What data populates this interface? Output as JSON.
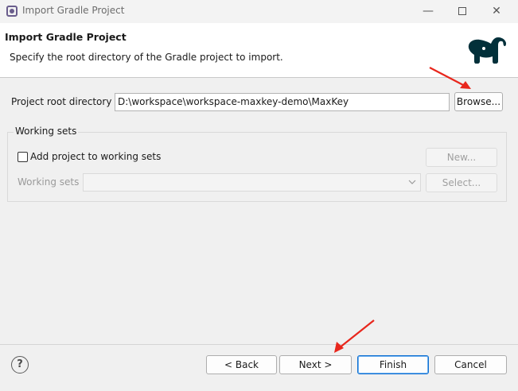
{
  "window": {
    "title": "Import Gradle Project",
    "icon": "eclipse-icon",
    "minimize": "—",
    "close": "✕"
  },
  "header": {
    "title": "Import Gradle Project",
    "description": "Specify the root directory of the Gradle project to import."
  },
  "root": {
    "label": "Project root directory",
    "value": "D:\\workspace\\workspace-maxkey-demo\\MaxKey",
    "browse_label": "Browse..."
  },
  "working_sets": {
    "group_title": "Working sets",
    "checkbox_label": "Add project to working sets",
    "checked": false,
    "new_label": "New...",
    "sets_label": "Working sets",
    "selected": "",
    "select_label": "Select..."
  },
  "footer": {
    "help": "?",
    "back_label": "< Back",
    "next_label": "Next >",
    "finish_label": "Finish",
    "cancel_label": "Cancel"
  },
  "colors": {
    "gradle_logo": "#02303a",
    "annotation_arrow": "#e8261c",
    "primary_focus": "#0f6fd0"
  }
}
